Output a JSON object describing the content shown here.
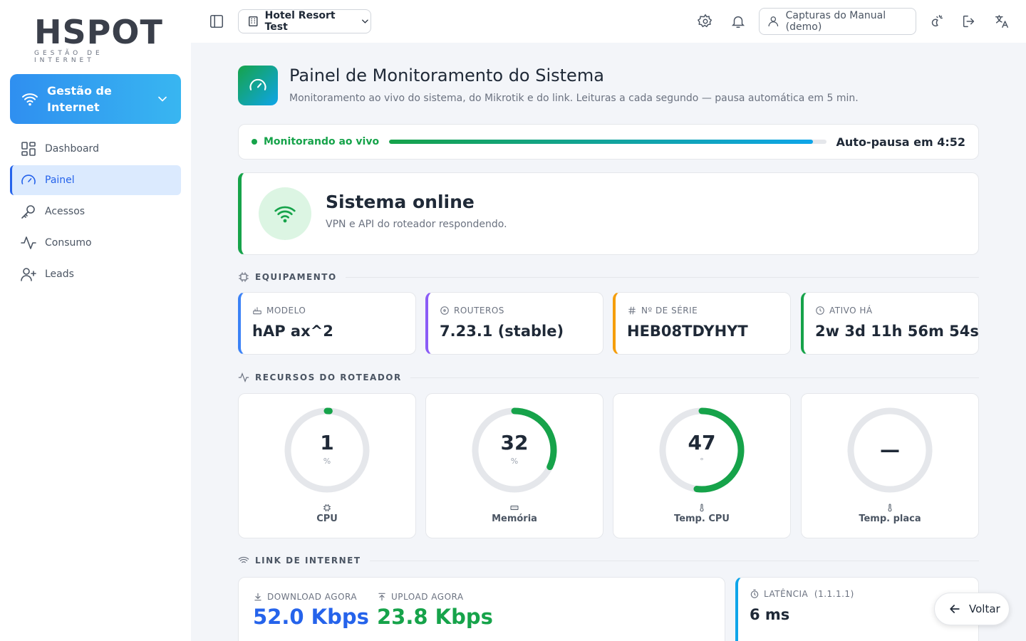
{
  "brand": {
    "name": "HSPOT",
    "tagline": "GESTÃO DE INTERNET"
  },
  "sidebar": {
    "group_label": "Gestão de Internet",
    "items": [
      {
        "label": "Dashboard",
        "icon": "dashboard-icon",
        "active": false
      },
      {
        "label": "Painel",
        "icon": "gauge-icon",
        "active": true
      },
      {
        "label": "Acessos",
        "icon": "key-icon",
        "active": false
      },
      {
        "label": "Consumo",
        "icon": "activity-icon",
        "active": false
      },
      {
        "label": "Leads",
        "icon": "user-plus-icon",
        "active": false
      }
    ]
  },
  "topbar": {
    "hotel": "Hotel Resort Test",
    "user": "Capturas do Manual (demo)"
  },
  "page": {
    "title": "Painel de Monitoramento do Sistema",
    "subtitle": "Monitoramento ao vivo do sistema, do Mikrotik e do link. Leituras a cada segundo — pausa automática em 5 min."
  },
  "live": {
    "label": "Monitorando ao vivo",
    "pause_label": "Auto-pausa em 4:52",
    "progress": 0.97
  },
  "status": {
    "title": "Sistema online",
    "subtitle": "VPN e API do roteador respondendo."
  },
  "sections": {
    "equipment": "EQUIPAMENTO",
    "resources": "RECURSOS DO ROTEADOR",
    "link": "LINK DE INTERNET"
  },
  "equipment": [
    {
      "label": "MODELO",
      "value": "hAP ax^2",
      "color": "#3b82f6"
    },
    {
      "label": "ROUTEROS",
      "value": "7.23.1 (stable)",
      "color": "#8b5cf6"
    },
    {
      "label": "Nº DE SÉRIE",
      "value": "HEB08TDYHYT",
      "color": "#f59e0b"
    },
    {
      "label": "ATIVO HÁ",
      "value": "2w 3d 11h 56m 54s",
      "color": "#16a34a"
    }
  ],
  "resources": [
    {
      "label": "CPU",
      "value": "1",
      "unit": "%",
      "percent": 1
    },
    {
      "label": "Memória",
      "value": "32",
      "unit": "%",
      "percent": 32
    },
    {
      "label": "Temp. CPU",
      "value": "47",
      "unit": "°",
      "percent": 52
    },
    {
      "label": "Temp. placa",
      "value": "—",
      "unit": "",
      "percent": 0
    }
  ],
  "link": {
    "download_label": "DOWNLOAD AGORA",
    "download_value": "52.0 Kbps",
    "upload_label": "UPLOAD AGORA",
    "upload_value": "23.8 Kbps",
    "latency_label": "LATÊNCIA",
    "latency_target": "(1.1.1.1)",
    "latency_value": "6 ms"
  },
  "colors": {
    "accent": "#16a34a",
    "download": "#2563eb",
    "upload": "#16a34a",
    "primary": "#2f8ff0"
  },
  "voltar_label": "Voltar"
}
